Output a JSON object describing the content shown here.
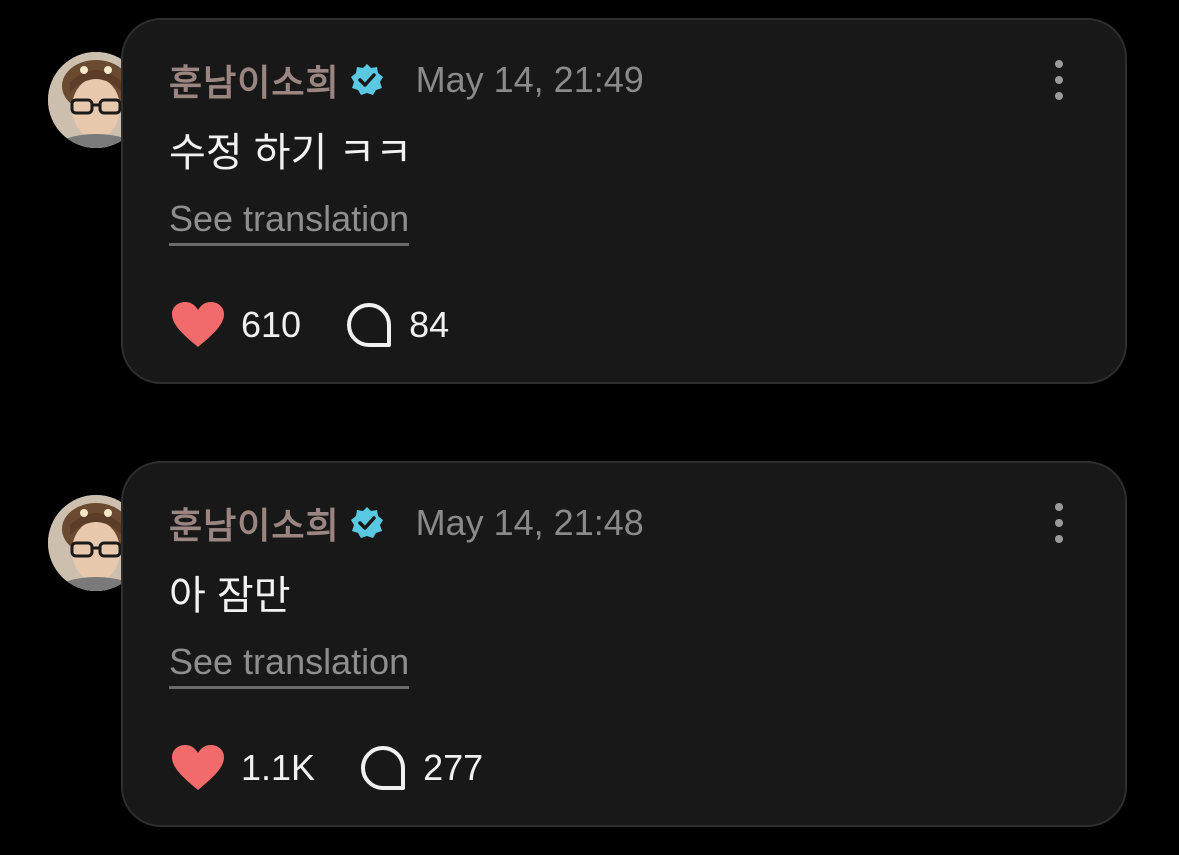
{
  "colors": {
    "background": "#000000",
    "card": "#181818",
    "username": "#9a8580",
    "verified": "#5ac8e0",
    "heart": "#f26b6b"
  },
  "posts": [
    {
      "username": "훈남이소희",
      "verified_icon": "verified-badge-icon",
      "timestamp": "May 14, 21:49",
      "text": "수정 하기 ㅋㅋ",
      "see_translation": "See translation",
      "likes": "610",
      "replies": "84"
    },
    {
      "username": "훈남이소희",
      "verified_icon": "verified-badge-icon",
      "timestamp": "May 14, 21:48",
      "text": "아 잠만",
      "see_translation": "See translation",
      "likes": "1.1K",
      "replies": "277"
    }
  ]
}
